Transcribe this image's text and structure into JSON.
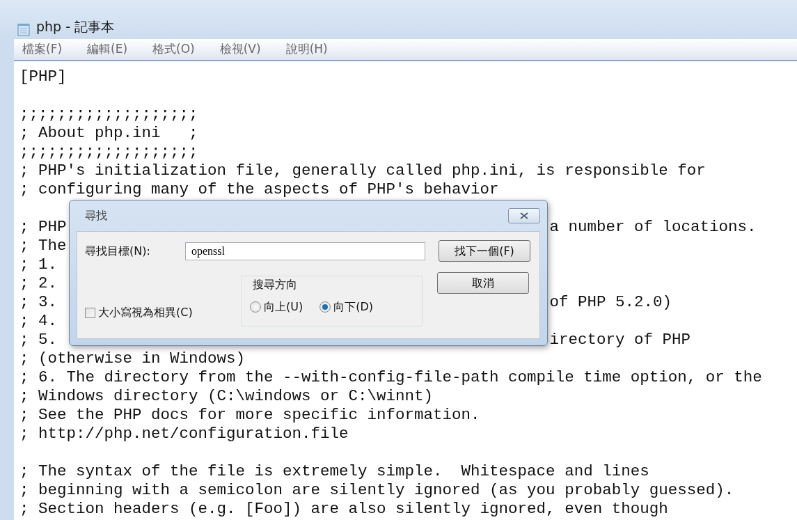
{
  "window": {
    "title": "php - 記事本"
  },
  "menu": [
    {
      "label": "檔案(F)"
    },
    {
      "label": "編輯(E)"
    },
    {
      "label": "格式(O)"
    },
    {
      "label": "檢視(V)"
    },
    {
      "label": "說明(H)"
    }
  ],
  "editor": {
    "lines": [
      {
        "kind": "text",
        "text": "[PHP]"
      },
      {
        "kind": "blank"
      },
      {
        "kind": "text",
        "text": ";;;;;;;;;;;;;;;;;;;"
      },
      {
        "kind": "text",
        "text": "; About php.ini   ;"
      },
      {
        "kind": "text",
        "text": ";;;;;;;;;;;;;;;;;;;"
      },
      {
        "kind": "text",
        "text": "; PHP's initialization file, generally called php.ini, is responsible for"
      },
      {
        "kind": "text",
        "text": "; configuring many of the aspects of PHP's behavior"
      },
      {
        "kind": "blank"
      },
      {
        "kind": "covered",
        "left": "; PHP",
        "right": "a number of locations."
      },
      {
        "kind": "covered",
        "left": "; The"
      },
      {
        "kind": "covered",
        "left": "; 1."
      },
      {
        "kind": "covered",
        "left": "; 2."
      },
      {
        "kind": "covered",
        "left": "; 3.",
        "right": "of PHP 5.2.0)"
      },
      {
        "kind": "covered",
        "left": "; 4."
      },
      {
        "kind": "covered",
        "left": "; 5.",
        "right": "irectory of PHP"
      },
      {
        "kind": "text",
        "text": "; (otherwise in Windows)"
      },
      {
        "kind": "text",
        "text": "; 6. The directory from the --with-config-file-path compile time option, or the"
      },
      {
        "kind": "text",
        "text": "; Windows directory (C:\\windows or C:\\winnt)"
      },
      {
        "kind": "text",
        "text": "; See the PHP docs for more specific information."
      },
      {
        "kind": "text",
        "text": "; http://php.net/configuration.file"
      },
      {
        "kind": "blank"
      },
      {
        "kind": "text",
        "text": "; The syntax of the file is extremely simple.  Whitespace and lines"
      },
      {
        "kind": "text",
        "text": "; beginning with a semicolon are silently ignored (as you probably guessed)."
      },
      {
        "kind": "text",
        "text": "; Section headers (e.g. [Foo]) are also silently ignored, even though"
      }
    ]
  },
  "find_dialog": {
    "title": "尋找",
    "find_label": "尋找目標(N):",
    "find_value": "openssl",
    "find_next_button": "找下一個(F)",
    "cancel_button": "取消",
    "match_case": {
      "label": "大小寫視為相異(C)",
      "checked": false
    },
    "direction": {
      "label": "搜尋方向",
      "options": [
        {
          "label": "向上(U)",
          "selected": false
        },
        {
          "label": "向下(D)",
          "selected": true
        }
      ]
    }
  }
}
